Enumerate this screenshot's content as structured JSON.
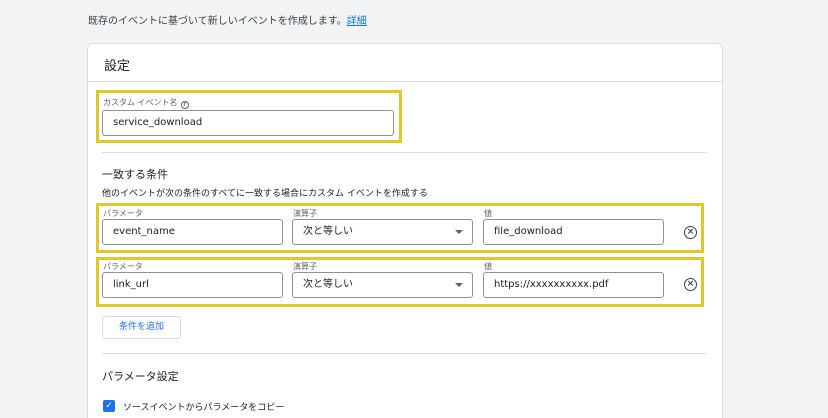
{
  "intro": {
    "text": "既存のイベントに基づいて新しいイベントを作成します。",
    "link": "詳細"
  },
  "settings": {
    "title": "設定",
    "custom_event_label": "カスタム イベント名",
    "help_icon": "?",
    "custom_event_value": "service_download"
  },
  "conditions": {
    "title": "一致する条件",
    "description": "他のイベントが次の条件のすべてに一致する場合にカスタム イベントを作成する",
    "rows": [
      {
        "param_label": "パラメータ",
        "param_value": "event_name",
        "op_label": "演算子",
        "op_value": "次と等しい",
        "val_label": "値",
        "val_value": "file_download"
      },
      {
        "param_label": "パラメータ",
        "param_value": "link_url",
        "op_label": "演算子",
        "op_value": "次と等しい",
        "val_label": "値",
        "val_value": "https://xxxxxxxxxx.pdf"
      }
    ],
    "add_button": "条件を追加"
  },
  "param_settings": {
    "title": "パラメータ設定",
    "copy_label": "ソースイベントからパラメータをコピー",
    "copy_checked": true
  },
  "icons": {
    "remove": "close-circle-icon",
    "check": "✓"
  },
  "colors": {
    "highlight": "#e2c72a",
    "accent": "#1a73e8",
    "background": "#f1f3f4"
  }
}
